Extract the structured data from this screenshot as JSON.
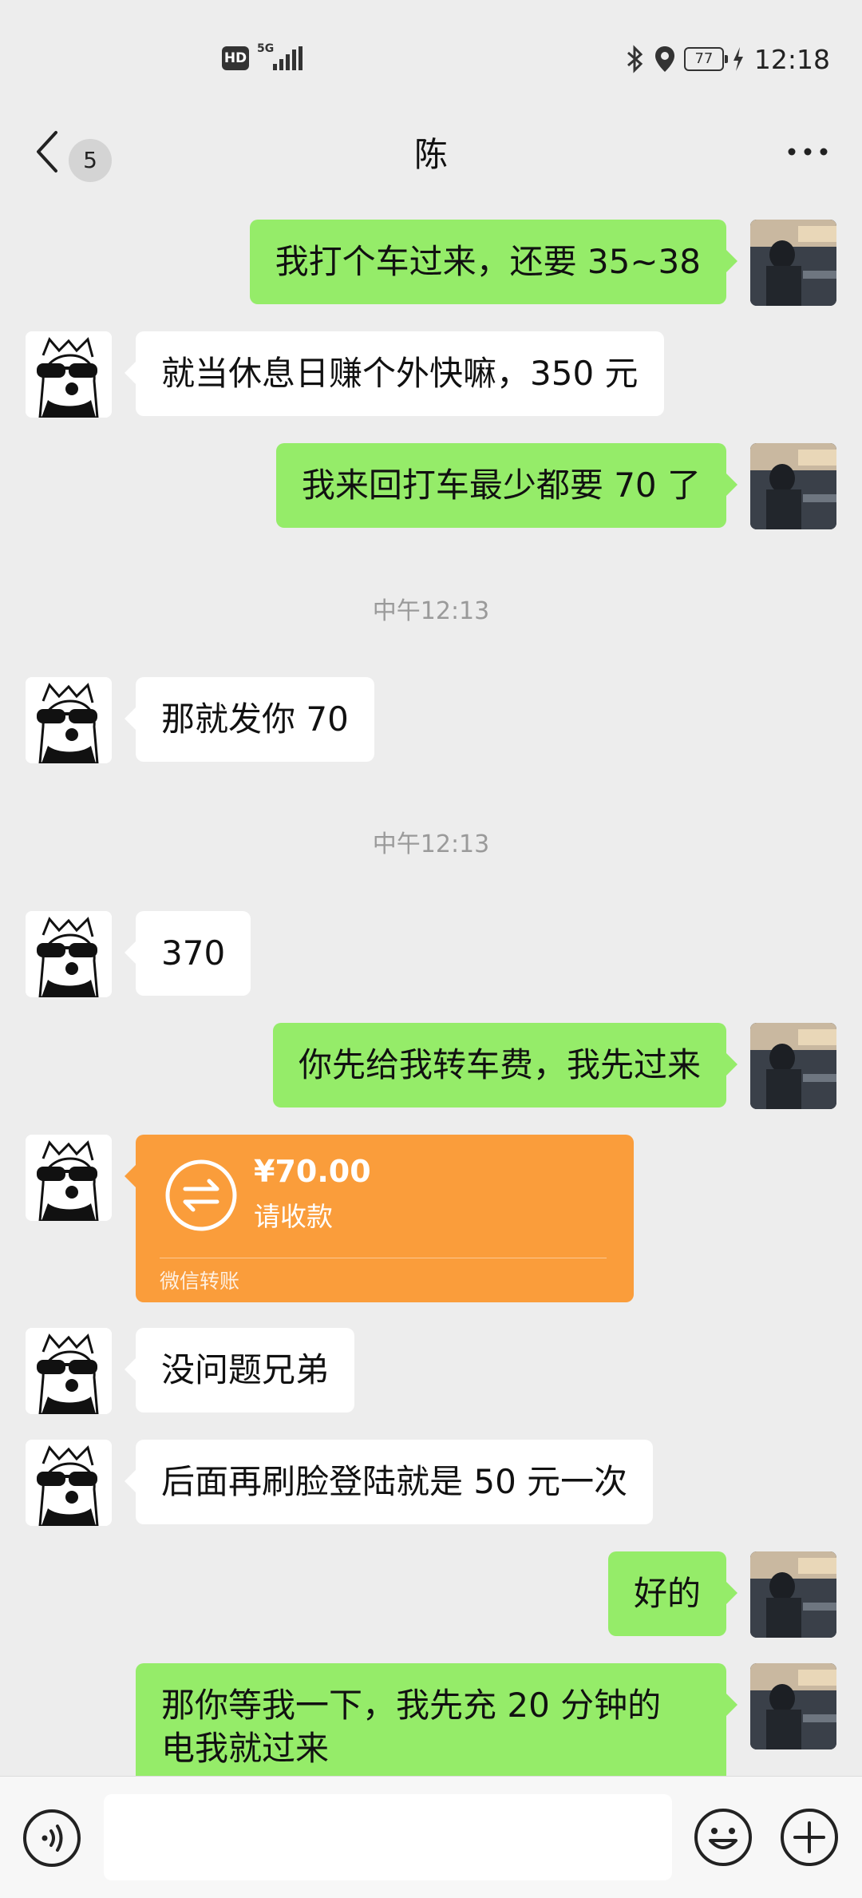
{
  "status_bar": {
    "hd": "HD",
    "network": "5G",
    "battery": "77",
    "time": "12:18"
  },
  "header": {
    "back_badge": "5",
    "title": "陈",
    "back_icon": "chevron-left-icon",
    "more_icon": "more-dots-icon"
  },
  "messages": [
    {
      "side": "right",
      "text": "我打个车过来，还要 35~38"
    },
    {
      "side": "left",
      "text": "就当休息日赚个外快嘛，350 元"
    },
    {
      "side": "right",
      "text": "我来回打车最少都要 70 了"
    },
    {
      "type": "timestamp",
      "text": "中午12:13"
    },
    {
      "side": "left",
      "text": "那就发你 70"
    },
    {
      "type": "timestamp",
      "text": "中午12:13"
    },
    {
      "side": "left",
      "text": "370"
    },
    {
      "side": "right",
      "text": "你先给我转车费，我先过来"
    },
    {
      "side": "left",
      "type": "transfer",
      "amount": "¥70.00",
      "desc": "请收款",
      "footer": "微信转账"
    },
    {
      "side": "left",
      "text": "没问题兄弟"
    },
    {
      "side": "left",
      "text": "后面再刷脸登陆就是 50 元一次"
    },
    {
      "side": "right",
      "text": "好的"
    },
    {
      "side": "right",
      "text_line1": "那你等我一下，我先充 20 分钟的",
      "text_line2": "电我就过来"
    }
  ],
  "input": {
    "placeholder": ""
  },
  "colors": {
    "sent_bubble": "#95ec69",
    "received_bubble": "#ffffff",
    "transfer": "#fa9d3b",
    "background": "#ededed"
  }
}
